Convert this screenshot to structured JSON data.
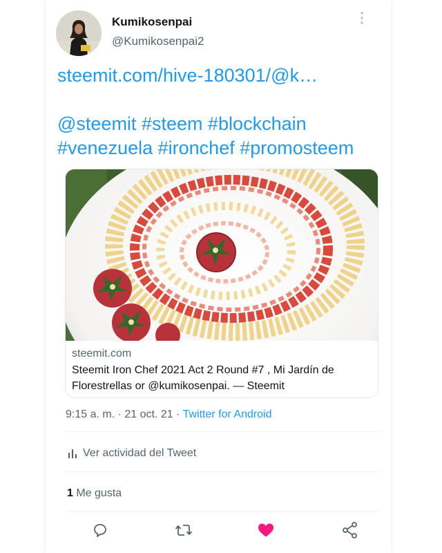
{
  "author": {
    "display_name": "Kumikosenpai",
    "username": "@Kumikosenpai2"
  },
  "tweet": {
    "link_text": "steemit.com/hive-180301/@k…",
    "hashtags_line1": [
      "@steemit",
      "#steem",
      "#blockchain"
    ],
    "hashtags_line2": [
      "#venezuela",
      "#ironchef",
      "#promosteem"
    ]
  },
  "link_card": {
    "domain": "steemit.com",
    "title": "Steemit Iron Chef 2021 Act 2 Round #7 , Mi Jardín de Florestrellas or @kumikosenpai. — Steemit"
  },
  "meta": {
    "time": "9:15 a. m.",
    "date": "21 oct. 21",
    "separator": "·",
    "client": "Twitter for Android"
  },
  "activity": {
    "label": "Ver actividad del Tweet"
  },
  "likes": {
    "count": "1",
    "label": "Me gusta"
  },
  "actions": {
    "icons": [
      "reply-icon",
      "retweet-icon",
      "like-icon",
      "share-icon"
    ]
  },
  "colors": {
    "link_blue": "#1d9bf0",
    "like_red": "#f91880",
    "secondary_text": "#536471",
    "primary_text": "#0f1419"
  }
}
